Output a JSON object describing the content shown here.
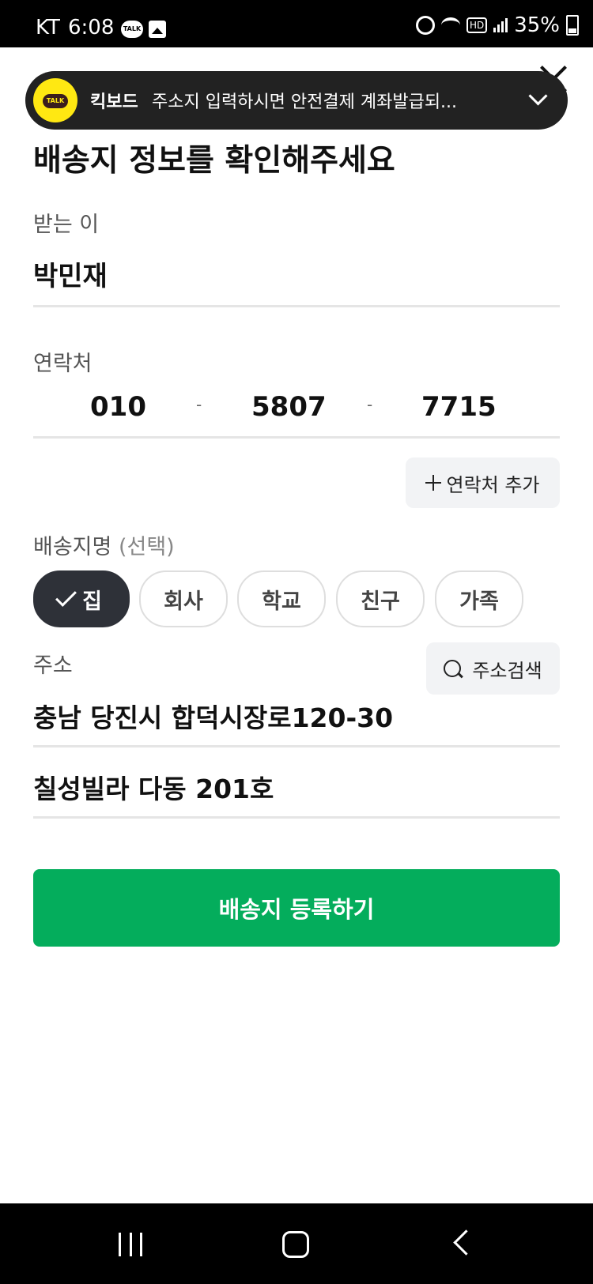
{
  "status_bar": {
    "carrier": "KT",
    "time": "6:08",
    "talk_label": "TALK",
    "hd_label": "HD",
    "battery": "35%"
  },
  "notification": {
    "logo_label": "TALK",
    "title": "킥보드",
    "message": "주소지 입력하시면 안전결제 계좌발급되..."
  },
  "page": {
    "title": "배송지 정보를 확인해주세요"
  },
  "recipient": {
    "label": "받는 이",
    "value": "박민재"
  },
  "contact": {
    "label": "연락처",
    "part1": "010",
    "part2": "5807",
    "part3": "7715",
    "separator": "-",
    "add_button": "연락처 추가"
  },
  "shipping_name": {
    "label": "배송지명",
    "optional": "(선택)",
    "chips": [
      {
        "label": "집",
        "selected": true
      },
      {
        "label": "회사",
        "selected": false
      },
      {
        "label": "학교",
        "selected": false
      },
      {
        "label": "친구",
        "selected": false
      },
      {
        "label": "가족",
        "selected": false
      }
    ]
  },
  "address": {
    "label": "주소",
    "search_button": "주소검색",
    "line1": "충남 당진시 합덕시장로120-30",
    "line2": "칠성빌라 다동 201호"
  },
  "submit_button": "배송지 등록하기",
  "colors": {
    "primary": "#04ad5c",
    "chip_selected": "#2e3138",
    "kakao_yellow": "#ffe812"
  }
}
